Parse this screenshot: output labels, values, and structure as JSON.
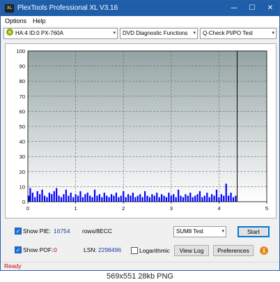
{
  "window": {
    "icon_text": "XL",
    "title": "PlexTools Professional XL V3.16",
    "minimize_glyph": "—",
    "maximize_glyph": "☐",
    "close_glyph": "✕"
  },
  "menu": {
    "items": [
      "Options",
      "Help"
    ]
  },
  "toolbar": {
    "drive": "HA:4 ID:0  PX-760A",
    "function": "DVD Diagnostic Functions",
    "test": "Q-Check PI/PO Test",
    "dropdown_glyph": "▾",
    "drive_icon": "disc-drive-icon"
  },
  "chart_data": {
    "type": "bar",
    "xlim": [
      0,
      5
    ],
    "ylim": [
      0,
      100
    ],
    "x_ticks": [
      "0",
      "1",
      "2",
      "3",
      "4",
      "5"
    ],
    "y_ticks": [
      "100",
      "90",
      "80",
      "70",
      "60",
      "50",
      "40",
      "30",
      "20",
      "10",
      "0"
    ],
    "grid": true,
    "end_marker_x": 4.38,
    "series": [
      {
        "color": "#0000ff",
        "x": [
          0.02,
          0.05,
          0.1,
          0.15,
          0.2,
          0.25,
          0.3,
          0.35,
          0.4,
          0.45,
          0.5,
          0.55,
          0.6,
          0.65,
          0.7,
          0.75,
          0.8,
          0.85,
          0.9,
          0.95,
          1.0,
          1.05,
          1.1,
          1.15,
          1.2,
          1.25,
          1.3,
          1.35,
          1.4,
          1.45,
          1.5,
          1.55,
          1.6,
          1.65,
          1.7,
          1.75,
          1.8,
          1.85,
          1.9,
          1.95,
          2.0,
          2.05,
          2.1,
          2.15,
          2.2,
          2.25,
          2.3,
          2.35,
          2.4,
          2.45,
          2.5,
          2.55,
          2.6,
          2.65,
          2.7,
          2.75,
          2.8,
          2.85,
          2.9,
          2.95,
          3.0,
          3.05,
          3.1,
          3.15,
          3.2,
          3.25,
          3.3,
          3.35,
          3.4,
          3.45,
          3.5,
          3.55,
          3.6,
          3.65,
          3.7,
          3.75,
          3.8,
          3.85,
          3.9,
          3.95,
          4.0,
          4.05,
          4.1,
          4.15,
          4.2,
          4.25,
          4.3,
          4.35
        ],
        "values": [
          4,
          9,
          6,
          3,
          7,
          5,
          8,
          4,
          3,
          6,
          5,
          7,
          9,
          4,
          3,
          5,
          8,
          4,
          6,
          3,
          5,
          4,
          7,
          3,
          5,
          6,
          4,
          3,
          8,
          4,
          5,
          3,
          6,
          4,
          3,
          5,
          4,
          6,
          3,
          4,
          7,
          3,
          5,
          4,
          6,
          3,
          4,
          5,
          3,
          7,
          4,
          3,
          5,
          4,
          6,
          3,
          5,
          4,
          3,
          6,
          4,
          5,
          3,
          8,
          4,
          3,
          5,
          4,
          6,
          3,
          4,
          5,
          7,
          3,
          4,
          6,
          3,
          5,
          4,
          8,
          3,
          5,
          4,
          12,
          4,
          6,
          3,
          4
        ]
      },
      {
        "color": "#008000",
        "x": [
          0.02,
          0.3,
          0.6,
          0.9,
          1.2,
          1.5,
          1.8,
          2.1,
          2.4,
          2.7,
          3.0,
          3.3,
          3.6,
          3.9,
          4.2,
          4.35
        ],
        "values": [
          1,
          1,
          0,
          1,
          0,
          1,
          0,
          1,
          0,
          1,
          0,
          1,
          0,
          1,
          1,
          0
        ]
      }
    ]
  },
  "controls": {
    "show_pie_label": "Show PIE:",
    "pie_value": "16754",
    "rows_label": "rows/8ECC",
    "show_pof_label": "Show POF:",
    "pof_value": "0",
    "lsn_label": "LSN:",
    "lsn_value": "2298496",
    "logarithmic_label": "Logarithmic",
    "sum_select": "SUM8 Test",
    "start_label": "Start",
    "viewlog_label": "View Log",
    "preferences_label": "Preferences",
    "check_glyph": "✓",
    "info_glyph": "i"
  },
  "status": {
    "text": "Ready"
  },
  "footer": {
    "text": "569x551  28kb  PNG"
  }
}
